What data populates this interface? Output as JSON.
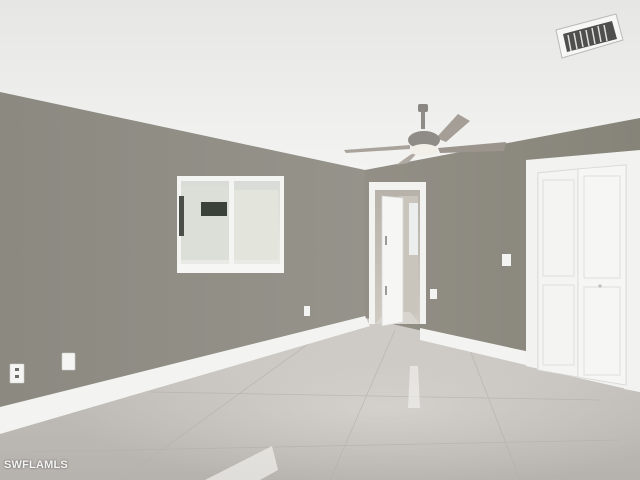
{
  "watermark": {
    "text": "SWFLAMLS"
  },
  "colors": {
    "ceiling": "#eeeeec",
    "wall_left": "#8f8d84",
    "wall_right": "#8c8a80",
    "trim": "#f3f3f1",
    "floor": "#c4c0bb",
    "door": "#f4f4f2"
  },
  "icons": [
    "ceiling-fan-icon",
    "air-vent-icon",
    "outlet-icon",
    "light-switch-icon"
  ]
}
